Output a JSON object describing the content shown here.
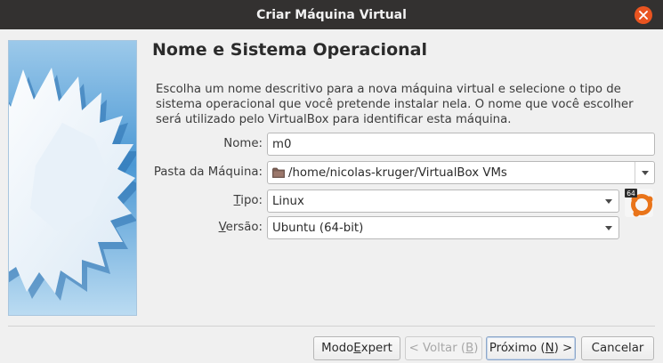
{
  "window": {
    "title": "Criar Máquina Virtual"
  },
  "page": {
    "title": "Nome e Sistema Operacional",
    "description": "Escolha um nome descritivo para a nova máquina virtual e selecione o tipo de sistema operacional que você pretende instalar nela. O nome que você escolher será utilizado pelo VirtualBox para identificar esta máquina."
  },
  "form": {
    "name": {
      "label": "Nome:",
      "value": "m0"
    },
    "folder": {
      "label": "Pasta da Máquina:",
      "value": "/home/nicolas-kruger/VirtualBox VMs",
      "icon": "folder-icon"
    },
    "type": {
      "label_before": "",
      "label_underlined": "T",
      "label_after": "ipo:",
      "value": "Linux"
    },
    "version": {
      "label_before": "",
      "label_underlined": "V",
      "label_after": "ersão:",
      "value": "Ubuntu (64-bit)"
    },
    "os_icon": {
      "badge": "64",
      "icon": "ubuntu-os-icon"
    }
  },
  "buttons": {
    "expert": {
      "before": "Modo ",
      "underlined": "E",
      "after": "xpert"
    },
    "back": {
      "before": "< Voltar (",
      "underlined": "B",
      "after": ")"
    },
    "next": {
      "before": "Próximo (",
      "underlined": "N",
      "after": ") >"
    },
    "cancel": {
      "label": "Cancelar"
    }
  },
  "colors": {
    "titlebar": "#333130",
    "close": "#e95420",
    "background": "#f0f0f0",
    "watermark_sky": "#3a88c8"
  }
}
